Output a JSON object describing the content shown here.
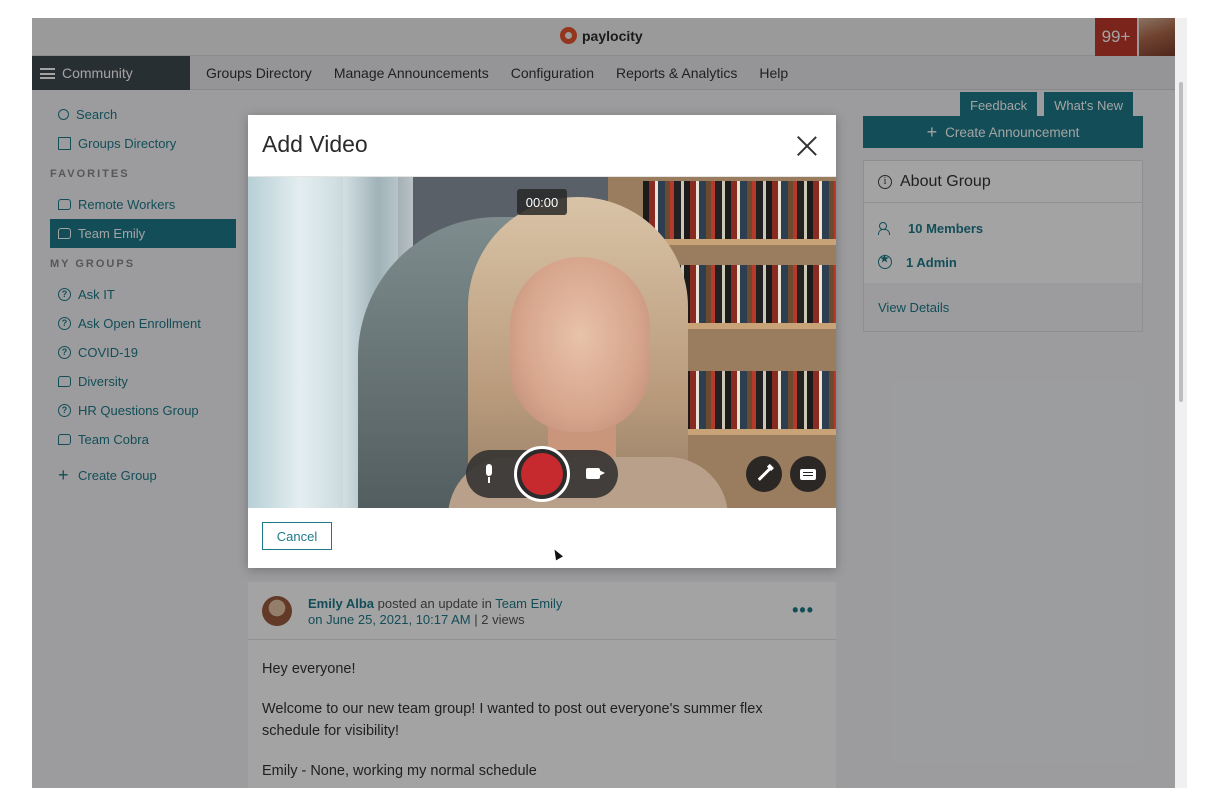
{
  "topbar": {
    "logo": "paylocity",
    "notifications": "99+"
  },
  "nav": {
    "menu_label": "Community",
    "items": [
      "Groups Directory",
      "Manage Announcements",
      "Configuration",
      "Reports & Analytics",
      "Help"
    ]
  },
  "sidebar": {
    "search": "Search",
    "groups_directory": "Groups Directory",
    "favorites_heading": "FAVORITES",
    "favorites": [
      "Remote Workers",
      "Team Emily"
    ],
    "my_groups_heading": "MY GROUPS",
    "my_groups": [
      "Ask IT",
      "Ask Open Enrollment",
      "COVID-19",
      "Diversity",
      "HR Questions Group",
      "Team Cobra"
    ],
    "create_group": "Create Group"
  },
  "right": {
    "feedback": "Feedback",
    "whats_new": "What's New",
    "create_announcement": "Create Announcement",
    "about_title": "About Group",
    "members": "10 Members",
    "admins": "1 Admin",
    "view_details": "View Details"
  },
  "modal": {
    "title": "Add Video",
    "timer": "00:00",
    "cancel": "Cancel"
  },
  "post": {
    "author": "Emily Alba",
    "action": "posted an update in",
    "group": "Team Emily",
    "date": "on June 25, 2021, 10:17 AM",
    "views": "| 2 views",
    "more": "•••",
    "lines": [
      "Hey everyone!",
      "Welcome to our new team group! I wanted to post out everyone's summer flex schedule for visibility!",
      "Emily - None, working my normal schedule"
    ]
  },
  "colors": {
    "accent": "#1e7a8a",
    "record": "#c62a2f",
    "badge": "#c0392b",
    "nav_dark": "#3f4a4f"
  }
}
